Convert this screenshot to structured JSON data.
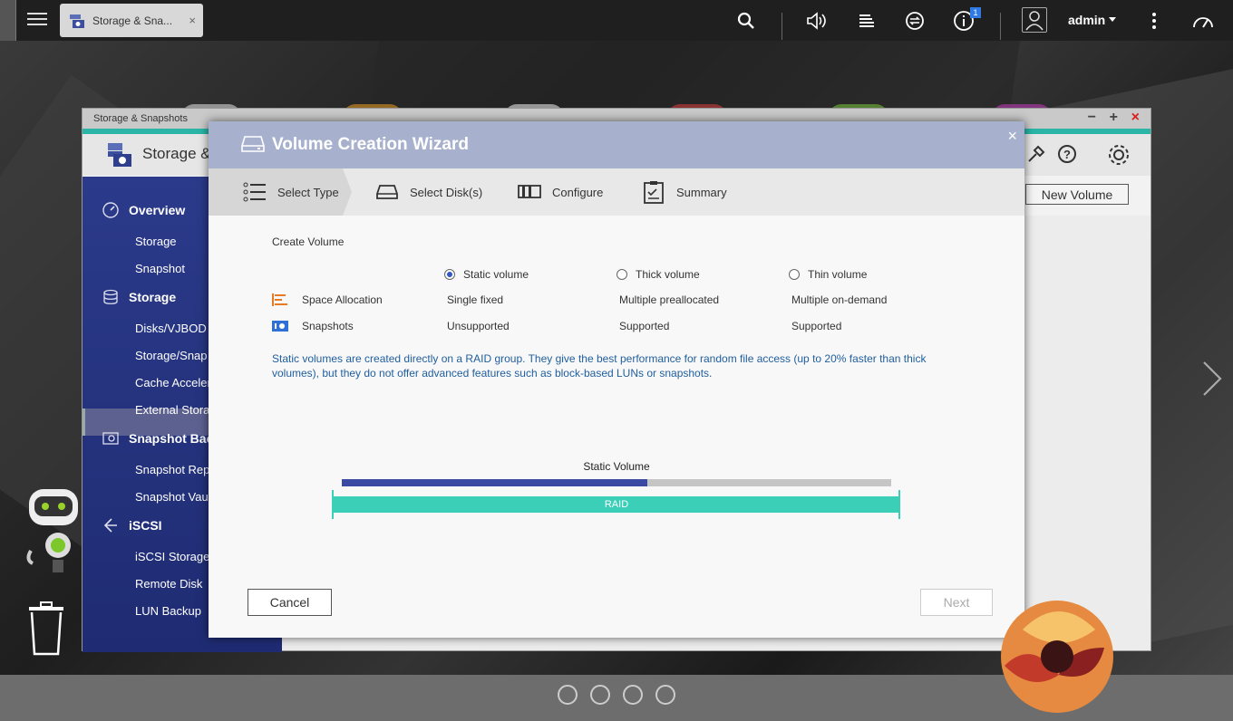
{
  "topbar": {
    "app_tab_label": "Storage & Sna...",
    "tab_close": "×",
    "notification_count": "1",
    "user": "admin"
  },
  "app": {
    "titlebar": "Storage & Snapshots",
    "header_name": "Storage &",
    "new_volume": "New Volume",
    "sidebar": {
      "sections": [
        {
          "label": "Overview",
          "icon": "gauge-icon"
        },
        {
          "label": "Storage",
          "icon": "database-icon"
        },
        {
          "label": "Snapshot Bac",
          "icon": "camera-icon"
        },
        {
          "label": "iSCSI",
          "icon": "iscsi-arrow-icon"
        }
      ],
      "items": [
        "Storage",
        "Snapshot",
        "Disks/VJBOD",
        "Storage/Snap",
        "Cache Acceler",
        "External Stora",
        "Snapshot Rep",
        "Snapshot Vau",
        "iSCSI Storage",
        "Remote Disk",
        "LUN Backup"
      ]
    }
  },
  "dialog": {
    "title": "Volume Creation Wizard",
    "close": "×",
    "steps": [
      {
        "label": "Select Type",
        "icon": "list-icon"
      },
      {
        "label": "Select Disk(s)",
        "icon": "disk-icon"
      },
      {
        "label": "Configure",
        "icon": "configure-icon"
      },
      {
        "label": "Summary",
        "icon": "clipboard-icon"
      }
    ],
    "create_volume": "Create Volume",
    "options": [
      {
        "label": "Static volume",
        "checked": true
      },
      {
        "label": "Thick volume",
        "checked": false
      },
      {
        "label": "Thin volume",
        "checked": false
      }
    ],
    "rows": [
      {
        "label": "Space Allocation",
        "icon": "allocation-icon",
        "values": [
          "Single fixed",
          "Multiple preallocated",
          "Multiple on-demand"
        ]
      },
      {
        "label": "Snapshots",
        "icon": "snapshot-icon",
        "values": [
          "Unsupported",
          "Supported",
          "Supported"
        ]
      }
    ],
    "description": "Static volumes are created directly on a RAID group. They give the best performance for random file access (up to 20% faster than thick volumes), but they do not offer advanced features such as block-based LUNs or snapshots.",
    "diagram": {
      "title": "Static Volume",
      "raid_label": "RAID",
      "volume_fraction": 0.556
    },
    "cancel": "Cancel",
    "next": "Next"
  },
  "colors": {
    "dialog_title": "#a7b1cd",
    "sidebar": "#2b3a8a",
    "raid": "#3ccfb8",
    "volume_bar": "#3a49a1",
    "description_text": "#1f5e9e",
    "accent_stripe": "#2ab5a7"
  }
}
